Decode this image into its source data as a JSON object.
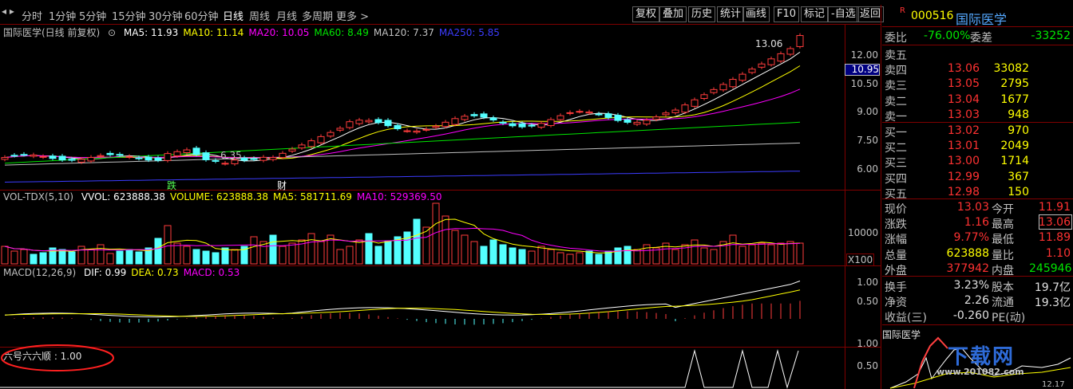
{
  "toolbar": {
    "nav_arrows": "◂ ▸",
    "periods": [
      "分时",
      "1分钟",
      "5分钟",
      "15分钟",
      "30分钟",
      "60分钟",
      "日线",
      "周线",
      "月线",
      "多周期",
      "更多 >"
    ],
    "active_period": "日线",
    "right_buttons": [
      "复权",
      "叠加",
      "历史",
      "统计",
      "画线",
      "F10",
      "标记",
      "-自选",
      "返回"
    ]
  },
  "main_chart": {
    "legend_name": "国际医学(日线 前复权)",
    "ma_labels": [
      {
        "text": "MA5: 11.93",
        "color": "#ffffff"
      },
      {
        "text": "MA10: 11.14",
        "color": "#ffff00"
      },
      {
        "text": "MA20: 10.05",
        "color": "#ff00ff"
      },
      {
        "text": "MA60: 8.49",
        "color": "#00e600"
      },
      {
        "text": "MA120: 7.37",
        "color": "#c0c0c0"
      },
      {
        "text": "MA250: 5.85",
        "color": "#3c3cff"
      }
    ],
    "y_ticks": [
      "12.00",
      "10.95",
      "10.50",
      "9.00",
      "7.50",
      "6.00"
    ],
    "y_tick_values": [
      12.0,
      10.95,
      10.5,
      9.0,
      7.5,
      6.0
    ],
    "high_label": "13.06",
    "low_label": "6.35",
    "marker_die": "跌",
    "marker_cai": "财"
  },
  "vol_panel": {
    "legend_name": "VOL-TDX(5,10)",
    "labels": [
      {
        "text": "VVOL: 623888.38",
        "color": "#ffffff"
      },
      {
        "text": "VOLUME: 623888.38",
        "color": "#ffff00"
      },
      {
        "text": "MA5: 581711.69",
        "color": "#ffff00"
      },
      {
        "text": "MA10: 529369.50",
        "color": "#ff00ff"
      }
    ],
    "y_tick": "10000",
    "unit": "X100"
  },
  "macd_panel": {
    "legend_name": "MACD(12,26,9)",
    "labels": [
      {
        "text": "DIF: 0.99",
        "color": "#ffffff"
      },
      {
        "text": "DEA: 0.73",
        "color": "#ffff00"
      },
      {
        "text": "MACD: 0.53",
        "color": "#ff00ff"
      }
    ],
    "y_ticks": [
      "1.00",
      "0.50"
    ]
  },
  "custom_panel": {
    "legend": "六号六六顺 : 1.00",
    "y_ticks": [
      "1.00",
      "0.50"
    ]
  },
  "quote": {
    "code": "000516",
    "name": "国际医学",
    "r_flag": "R",
    "weibi_label": "委比",
    "weibi": "-76.00%",
    "weicha_label": "委差",
    "weicha": "-33252",
    "sell": [
      {
        "label": "卖五",
        "price": "",
        "vol": ""
      },
      {
        "label": "卖四",
        "price": "13.06",
        "vol": "33082"
      },
      {
        "label": "卖三",
        "price": "13.05",
        "vol": "2795"
      },
      {
        "label": "卖二",
        "price": "13.04",
        "vol": "1677"
      },
      {
        "label": "卖一",
        "price": "13.03",
        "vol": "948"
      }
    ],
    "buy": [
      {
        "label": "买一",
        "price": "13.02",
        "vol": "970"
      },
      {
        "label": "买二",
        "price": "13.01",
        "vol": "2049"
      },
      {
        "label": "买三",
        "price": "13.00",
        "vol": "1714"
      },
      {
        "label": "买四",
        "price": "12.99",
        "vol": "367"
      },
      {
        "label": "买五",
        "price": "12.98",
        "vol": "150"
      }
    ],
    "stats": [
      {
        "l1": "现价",
        "v1": "13.03",
        "c1": "red",
        "l2": "今开",
        "v2": "11.91",
        "c2": "red"
      },
      {
        "l1": "涨跌",
        "v1": "1.16",
        "c1": "red",
        "l2": "最高",
        "v2": "13.06",
        "c2": "red"
      },
      {
        "l1": "涨幅",
        "v1": "9.77%",
        "c1": "red",
        "l2": "最低",
        "v2": "11.89",
        "c2": "red"
      },
      {
        "l1": "总量",
        "v1": "623888",
        "c1": "yellow",
        "l2": "量比",
        "v2": "1.10",
        "c2": "red"
      },
      {
        "l1": "外盘",
        "v1": "377942",
        "c1": "red",
        "l2": "内盘",
        "v2": "245946",
        "c2": "green"
      }
    ],
    "stats2": [
      {
        "l1": "换手",
        "v1": "3.23%",
        "l2": "股本",
        "v2": "19.7亿"
      },
      {
        "l1": "净资",
        "v1": "2.26",
        "l2": "流通",
        "v2": "19.3亿"
      },
      {
        "l1": "收益(三)",
        "v1": "-0.260",
        "l2": "PE(动)",
        "v2": ""
      }
    ],
    "mini_title": "国际医学",
    "watermark": "下载网",
    "watermark_url": "www.201082.com",
    "mini_price": "12.17"
  }
}
